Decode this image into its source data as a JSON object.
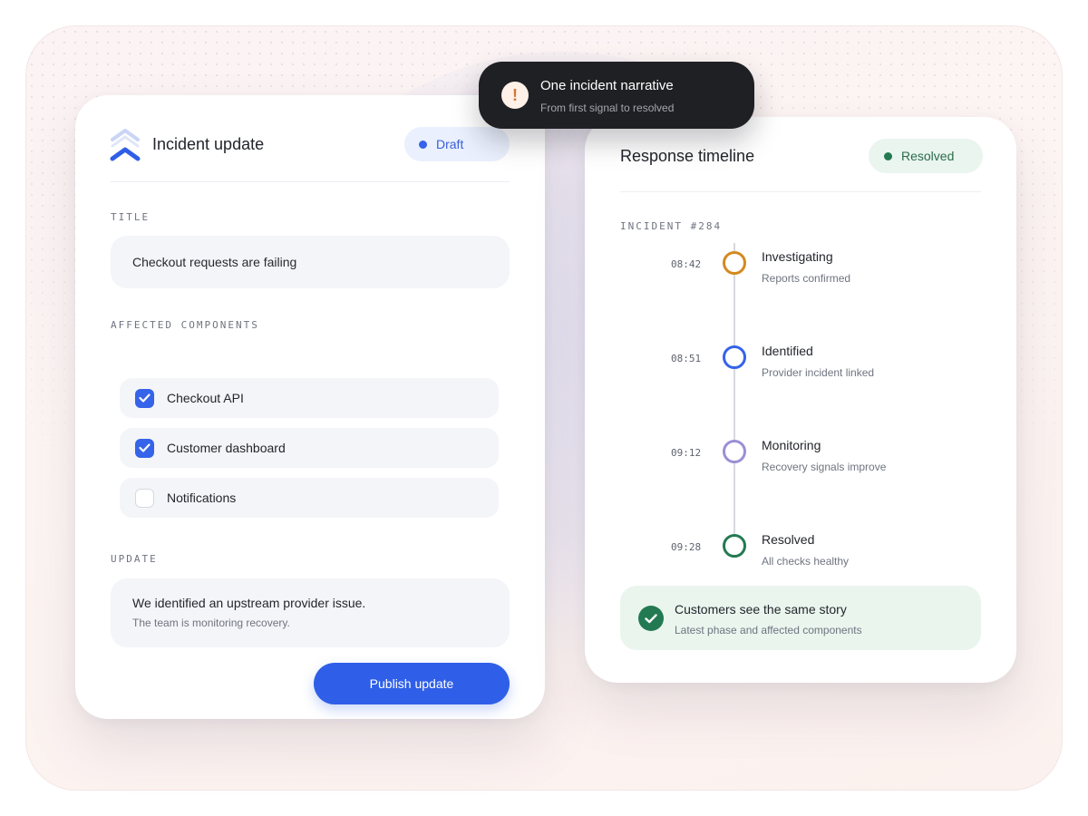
{
  "toast": {
    "title": "One incident narrative",
    "subtitle": "From first signal to resolved",
    "icon": "exclamation-icon"
  },
  "incident_update": {
    "title": "Incident update",
    "status": "Draft",
    "title_label": "TITLE",
    "title_value": "Checkout requests are failing",
    "components_label": "AFFECTED COMPONENTS",
    "components": [
      {
        "label": "Checkout API",
        "checked": true
      },
      {
        "label": "Customer dashboard",
        "checked": true
      },
      {
        "label": "Notifications",
        "checked": false
      }
    ],
    "update_label": "UPDATE",
    "update_text": "We identified an upstream provider issue.",
    "update_subtext": "The team is monitoring recovery.",
    "publish_button": "Publish update"
  },
  "timeline": {
    "title": "Response timeline",
    "status": "Resolved",
    "incident_label": "INCIDENT #284",
    "events": [
      {
        "time": "08:42",
        "phase": "Investigating",
        "detail": "Reports confirmed",
        "color": "#d4891f"
      },
      {
        "time": "08:51",
        "phase": "Identified",
        "detail": "Provider incident linked",
        "color": "#3563e9"
      },
      {
        "time": "09:12",
        "phase": "Monitoring",
        "detail": "Recovery signals improve",
        "color": "#9b8fd6"
      },
      {
        "time": "09:28",
        "phase": "Resolved",
        "detail": "All checks healthy",
        "color": "#237a52"
      }
    ],
    "summary_title": "Customers see the same story",
    "summary_subtitle": "Latest phase and affected components"
  },
  "colors": {
    "accent": "#2f5fe8",
    "resolved": "#237a52",
    "toast_bg": "#1f2024"
  }
}
